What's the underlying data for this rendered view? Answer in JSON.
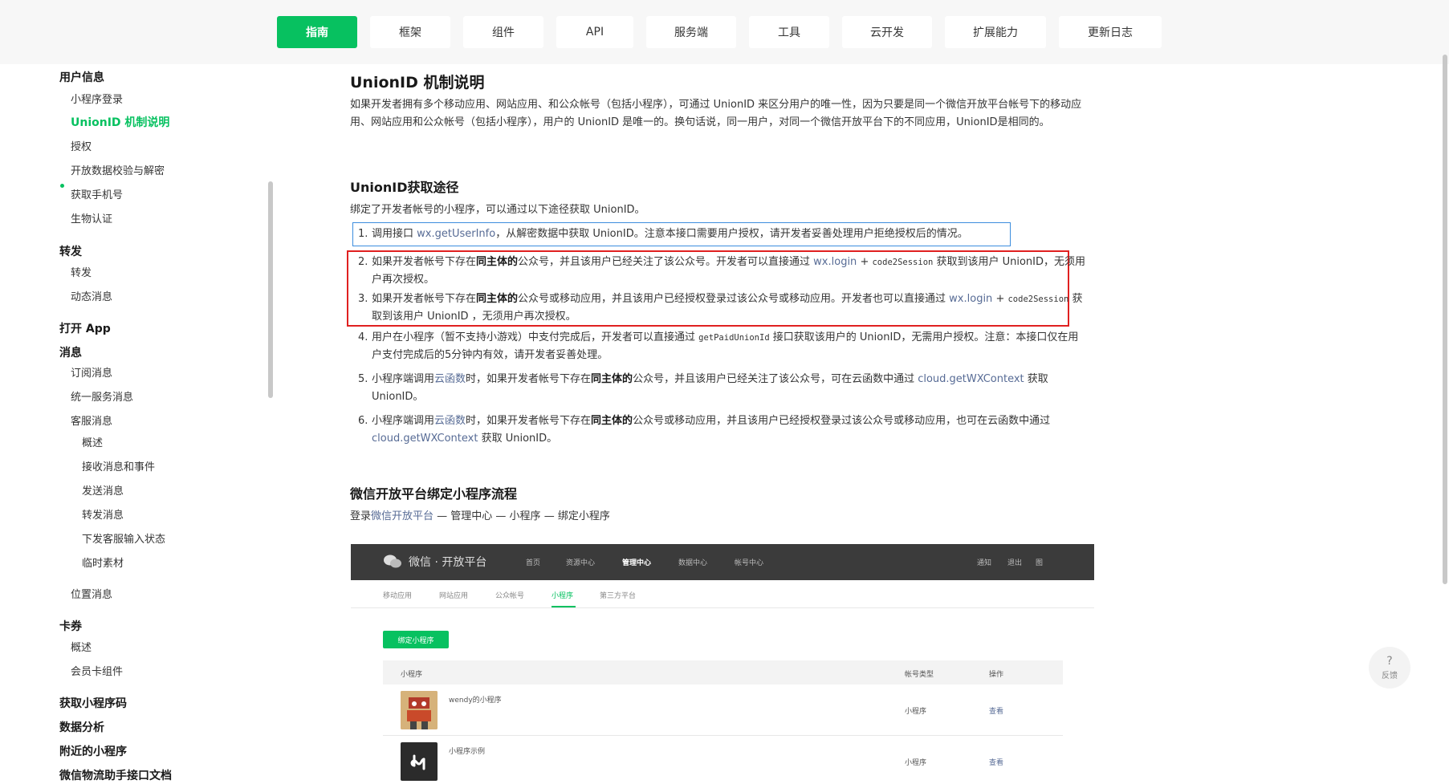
{
  "nav": {
    "tabs": [
      {
        "label": "指南",
        "active": true
      },
      {
        "label": "框架"
      },
      {
        "label": "组件"
      },
      {
        "label": "API"
      },
      {
        "label": "服务端"
      },
      {
        "label": "工具"
      },
      {
        "label": "云开发"
      },
      {
        "label": "扩展能力"
      },
      {
        "label": "更新日志"
      }
    ]
  },
  "sidebar": {
    "items": [
      {
        "label": "用户信息",
        "kind": "section"
      },
      {
        "label": "小程序登录",
        "kind": "item"
      },
      {
        "label": "UnionID 机制说明",
        "kind": "current"
      },
      {
        "label": "授权",
        "kind": "item"
      },
      {
        "label": "开放数据校验与解密",
        "kind": "item"
      },
      {
        "label": "获取手机号",
        "kind": "item"
      },
      {
        "label": "生物认证",
        "kind": "item"
      },
      {
        "label": "转发",
        "kind": "section"
      },
      {
        "label": "转发",
        "kind": "item"
      },
      {
        "label": "动态消息",
        "kind": "item"
      },
      {
        "label": "打开 App",
        "kind": "section"
      },
      {
        "label": "消息",
        "kind": "section"
      },
      {
        "label": "订阅消息",
        "kind": "item"
      },
      {
        "label": "统一服务消息",
        "kind": "item"
      },
      {
        "label": "客服消息",
        "kind": "item"
      },
      {
        "label": "概述",
        "kind": "sub"
      },
      {
        "label": "接收消息和事件",
        "kind": "sub"
      },
      {
        "label": "发送消息",
        "kind": "sub"
      },
      {
        "label": "转发消息",
        "kind": "sub"
      },
      {
        "label": "下发客服输入状态",
        "kind": "sub"
      },
      {
        "label": "临时素材",
        "kind": "sub"
      },
      {
        "label": "位置消息",
        "kind": "item"
      },
      {
        "label": "卡券",
        "kind": "section"
      },
      {
        "label": "概述",
        "kind": "item"
      },
      {
        "label": "会员卡组件",
        "kind": "item"
      },
      {
        "label": "获取小程序码",
        "kind": "section"
      },
      {
        "label": "数据分析",
        "kind": "section"
      },
      {
        "label": "附近的小程序",
        "kind": "section"
      },
      {
        "label": "微信物流助手接口文档",
        "kind": "section"
      }
    ]
  },
  "main": {
    "title": "UnionID 机制说明",
    "intro": "如果开发者拥有多个移动应用、网站应用、和公众帐号（包括小程序），可通过 UnionID 来区分用户的唯一性，因为只要是同一个微信开放平台帐号下的移动应用、网站应用和公众帐号（包括小程序），用户的 UnionID 是唯一的。换句话说，同一用户，对同一个微信开放平台下的不同应用，UnionID是相同的。",
    "section1_title": "UnionID获取途径",
    "section1_desc": "绑定了开发者帐号的小程序，可以通过以下途径获取 UnionID。",
    "list": {
      "i1": {
        "num": "1.",
        "a": "调用接口 ",
        "link": "wx.getUserInfo",
        "b": "，从解密数据中获取 UnionID。注意本接口需要用户授权，请开发者妥善处理用户拒绝授权后的情况。"
      },
      "i2": {
        "num": "2.",
        "a": "如果开发者帐号下存在",
        "bold": "同主体的",
        "b": "公众号，并且该用户已经关注了该公众号。开发者可以直接通过 ",
        "link": "wx.login",
        "c": " + ",
        "code": "code2Session",
        "d": " 获取到该用户 UnionID，无须用户再次授权。"
      },
      "i3": {
        "num": "3.",
        "a": "如果开发者帐号下存在",
        "bold": "同主体的",
        "b": "公众号或移动应用，并且该用户已经授权登录过该公众号或移动应用。开发者也可以直接通过 ",
        "link": "wx.login",
        "c": " + ",
        "code": "code2Session",
        "d": " 获取到该用户 UnionID ，无须用户再次授权。"
      },
      "i4": {
        "num": "4.",
        "a": "用户在小程序（暂不支持小游戏）中支付完成后，开发者可以直接通过 ",
        "code": "getPaidUnionId",
        "b": " 接口获取该用户的 UnionID，无需用户授权。注意：本接口仅在用户支付完成后的5分钟内有效，请开发者妥善处理。"
      },
      "i5": {
        "num": "5.",
        "a": "小程序端调用",
        "link1": "云函数",
        "b": "时，如果开发者帐号下存在",
        "bold": "同主体的",
        "c": "公众号，并且该用户已经关注了该公众号，可在云函数中通过 ",
        "link2": "cloud.getWXContext",
        "d": " 获取 UnionID。"
      },
      "i6": {
        "num": "6.",
        "a": "小程序端调用",
        "link1": "云函数",
        "b": "时，如果开发者帐号下存在",
        "bold": "同主体的",
        "c": "公众号或移动应用，并且该用户已经授权登录过该公众号或移动应用，也可在云函数中通过 ",
        "link2": "cloud.getWXContext",
        "d": " 获取 UnionID。"
      }
    },
    "section2_title": "微信开放平台绑定小程序流程",
    "section2_a": "登录",
    "section2_link": "微信开放平台",
    "section2_b": " — 管理中心 — 小程序 — 绑定小程序"
  },
  "shot": {
    "logo": "微信 · 开放平台",
    "nav": [
      "首页",
      "资源中心",
      "管理中心",
      "数据中心",
      "帐号中心"
    ],
    "right": [
      "通知",
      "退出",
      "图"
    ],
    "tabs": [
      "移动应用",
      "网站应用",
      "公众帐号",
      "小程序",
      "第三方平台"
    ],
    "bind_button": "绑定小程序",
    "table": {
      "headers": [
        "小程序",
        "帐号类型",
        "操作"
      ],
      "rows": [
        {
          "name": "wendy的小程序",
          "type": "小程序",
          "action": "查看"
        },
        {
          "name": "小程序示例",
          "type": "小程序",
          "action": "查看"
        }
      ]
    }
  },
  "feedback": {
    "icon": "?",
    "label": "反馈"
  },
  "colors": {
    "brand": "#07c160",
    "link": "#576b95",
    "highlight_red": "#e02020",
    "highlight_blue": "#3c8dde"
  }
}
